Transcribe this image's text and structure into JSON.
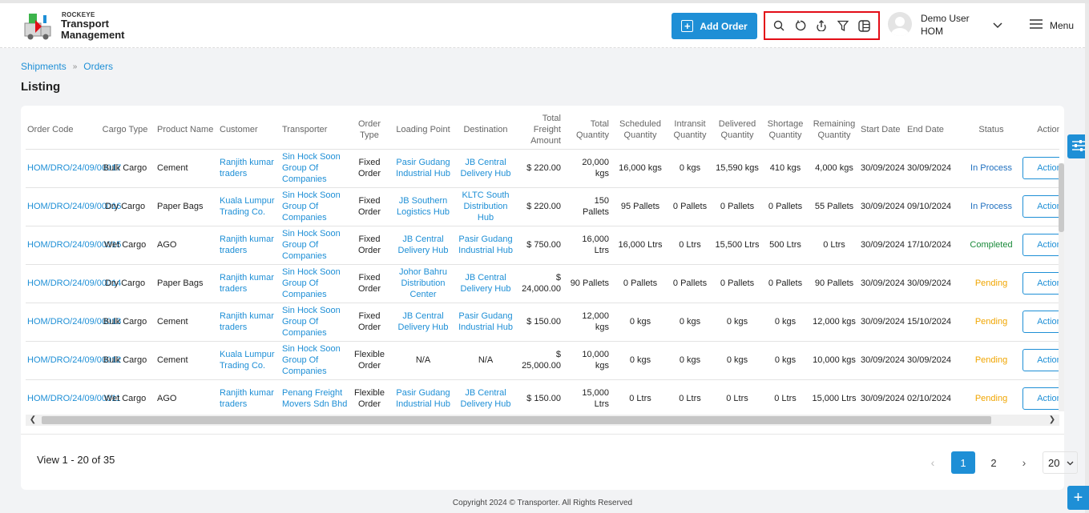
{
  "header": {
    "brand_small": "ROCKEYE",
    "brand_title": "Transport Management",
    "add_order_label": "Add Order",
    "user_name": "Demo User",
    "user_org": "HOM",
    "menu_label": "Menu",
    "toolbar_icons": [
      "search-icon",
      "refresh-icon",
      "upload-icon",
      "filter-icon",
      "columns-icon"
    ]
  },
  "breadcrumb": {
    "items": [
      "Shipments",
      "Orders"
    ]
  },
  "page": {
    "title": "Listing"
  },
  "table": {
    "columns": [
      "Order Code",
      "Cargo Type",
      "Product Name",
      "Customer",
      "Transporter",
      "Order Type",
      "Loading Point",
      "Destination",
      "Total Freight Amount",
      "Total Quantity",
      "Scheduled Quantity",
      "Intransit Quantity",
      "Delivered Quantity",
      "Shortage Quantity",
      "Remaining Quantity",
      "Start Date",
      "End Date",
      "Status",
      "Action"
    ],
    "rows": [
      {
        "order_code": "HOM/DRO/24/09/00017",
        "cargo_type": "Bulk Cargo",
        "product": "Cement",
        "customer": "Ranjith kumar traders",
        "transporter": "Sin Hock Soon Group Of Companies",
        "order_type": "Fixed Order",
        "loading_point": "Pasir Gudang Industrial Hub",
        "destination": "JB Central Delivery Hub",
        "freight": "$ 220.00",
        "total_qty": "20,000 kgs",
        "scheduled": "16,000 kgs",
        "intransit": "0 kgs",
        "delivered": "15,590 kgs",
        "shortage": "410 kgs",
        "remaining": "4,000 kgs",
        "start_date": "30/09/2024",
        "end_date": "30/09/2024",
        "status": "In Process",
        "status_class": "st-proc",
        "action": "Action"
      },
      {
        "order_code": "HOM/DRO/24/09/00016",
        "cargo_type": "Dry Cargo",
        "product": "Paper Bags",
        "customer": "Kuala Lumpur Trading Co.",
        "transporter": "Sin Hock Soon Group Of Companies",
        "order_type": "Fixed Order",
        "loading_point": "JB Southern Logistics Hub",
        "destination": "KLTC South Distribution Hub",
        "freight": "$ 220.00",
        "total_qty": "150 Pallets",
        "scheduled": "95 Pallets",
        "intransit": "0 Pallets",
        "delivered": "0 Pallets",
        "shortage": "0 Pallets",
        "remaining": "55 Pallets",
        "start_date": "30/09/2024",
        "end_date": "09/10/2024",
        "status": "In Process",
        "status_class": "st-proc",
        "action": "Action"
      },
      {
        "order_code": "HOM/DRO/24/09/00015",
        "cargo_type": "Wet Cargo",
        "product": "AGO",
        "customer": "Ranjith kumar traders",
        "transporter": "Sin Hock Soon Group Of Companies",
        "order_type": "Fixed Order",
        "loading_point": "JB Central Delivery Hub",
        "destination": "Pasir Gudang Industrial Hub",
        "freight": "$ 750.00",
        "total_qty": "16,000 Ltrs",
        "scheduled": "16,000 Ltrs",
        "intransit": "0 Ltrs",
        "delivered": "15,500 Ltrs",
        "shortage": "500 Ltrs",
        "remaining": "0 Ltrs",
        "start_date": "30/09/2024",
        "end_date": "17/10/2024",
        "status": "Completed",
        "status_class": "st-done",
        "action": "Action"
      },
      {
        "order_code": "HOM/DRO/24/09/00014",
        "cargo_type": "Dry Cargo",
        "product": "Paper Bags",
        "customer": "Ranjith kumar traders",
        "transporter": "Sin Hock Soon Group Of Companies",
        "order_type": "Fixed Order",
        "loading_point": "Johor Bahru Distribution Center",
        "destination": "JB Central Delivery Hub",
        "freight": "$ 24,000.00",
        "total_qty": "90 Pallets",
        "scheduled": "0 Pallets",
        "intransit": "0 Pallets",
        "delivered": "0 Pallets",
        "shortage": "0 Pallets",
        "remaining": "90 Pallets",
        "start_date": "30/09/2024",
        "end_date": "30/09/2024",
        "status": "Pending",
        "status_class": "st-pend",
        "action": "Action"
      },
      {
        "order_code": "HOM/DRO/24/09/00013",
        "cargo_type": "Bulk Cargo",
        "product": "Cement",
        "customer": "Ranjith kumar traders",
        "transporter": "Sin Hock Soon Group Of Companies",
        "order_type": "Fixed Order",
        "loading_point": "JB Central Delivery Hub",
        "destination": "Pasir Gudang Industrial Hub",
        "freight": "$ 150.00",
        "total_qty": "12,000 kgs",
        "scheduled": "0 kgs",
        "intransit": "0 kgs",
        "delivered": "0 kgs",
        "shortage": "0 kgs",
        "remaining": "12,000 kgs",
        "start_date": "30/09/2024",
        "end_date": "15/10/2024",
        "status": "Pending",
        "status_class": "st-pend",
        "action": "Action"
      },
      {
        "order_code": "HOM/DRO/24/09/00012",
        "cargo_type": "Bulk Cargo",
        "product": "Cement",
        "customer": "Kuala Lumpur Trading Co.",
        "transporter": "Sin Hock Soon Group Of Companies",
        "order_type": "Flexible Order",
        "loading_point": "N/A",
        "destination": "N/A",
        "freight": "$ 25,000.00",
        "total_qty": "10,000 kgs",
        "scheduled": "0 kgs",
        "intransit": "0 kgs",
        "delivered": "0 kgs",
        "shortage": "0 kgs",
        "remaining": "10,000 kgs",
        "start_date": "30/09/2024",
        "end_date": "30/09/2024",
        "status": "Pending",
        "status_class": "st-pend",
        "action": "Action"
      },
      {
        "order_code": "HOM/DRO/24/09/00011",
        "cargo_type": "Wet Cargo",
        "product": "AGO",
        "customer": "Ranjith kumar traders",
        "transporter": "Penang Freight Movers Sdn Bhd",
        "order_type": "Flexible Order",
        "loading_point": "Pasir Gudang Industrial Hub",
        "destination": "JB Central Delivery Hub",
        "freight": "$ 150.00",
        "total_qty": "15,000 Ltrs",
        "scheduled": "0 Ltrs",
        "intransit": "0 Ltrs",
        "delivered": "0 Ltrs",
        "shortage": "0 Ltrs",
        "remaining": "15,000 Ltrs",
        "start_date": "30/09/2024",
        "end_date": "02/10/2024",
        "status": "Pending",
        "status_class": "st-pend",
        "action": "Action"
      }
    ]
  },
  "pagination": {
    "info": "View 1 - 20 of 35",
    "pages": [
      "1",
      "2"
    ],
    "current": "1",
    "per_page": "20"
  },
  "footer": {
    "text": "Copyright 2024 © Transporter. All Rights Reserved"
  },
  "colors": {
    "accent": "#1e8fd6",
    "highlight_border": "#e30d17",
    "completed": "#1a8a3a",
    "pending": "#f0a500"
  }
}
